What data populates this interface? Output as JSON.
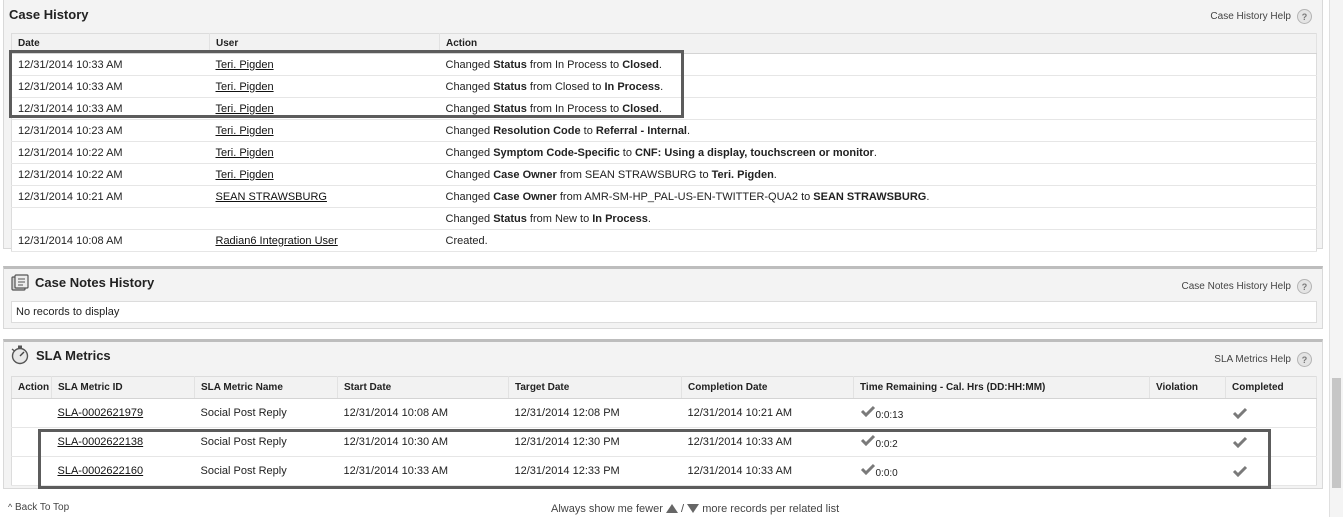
{
  "case_history": {
    "title": "Case History",
    "help_label": "Case History Help",
    "help_glyph": "?",
    "columns": [
      "Date",
      "User",
      "Action"
    ],
    "rows": [
      {
        "date": "12/31/2014 10:33 AM",
        "user": "Teri. Pigden",
        "action": [
          [
            "Changed ",
            false
          ],
          [
            "Status",
            true
          ],
          [
            " from In Process to ",
            false
          ],
          [
            "Closed",
            true
          ],
          [
            ".",
            false
          ]
        ]
      },
      {
        "date": "12/31/2014 10:33 AM",
        "user": "Teri. Pigden",
        "action": [
          [
            "Changed ",
            false
          ],
          [
            "Status",
            true
          ],
          [
            " from Closed to ",
            false
          ],
          [
            "In Process",
            true
          ],
          [
            ".",
            false
          ]
        ]
      },
      {
        "date": "12/31/2014 10:33 AM",
        "user": "Teri. Pigden",
        "action": [
          [
            "Changed ",
            false
          ],
          [
            "Status",
            true
          ],
          [
            " from In Process to ",
            false
          ],
          [
            "Closed",
            true
          ],
          [
            ".",
            false
          ]
        ]
      },
      {
        "date": "12/31/2014 10:23 AM",
        "user": "Teri. Pigden",
        "action": [
          [
            "Changed ",
            false
          ],
          [
            "Resolution Code",
            true
          ],
          [
            " to ",
            false
          ],
          [
            "Referral - Internal",
            true
          ],
          [
            ".",
            false
          ]
        ]
      },
      {
        "date": "12/31/2014 10:22 AM",
        "user": "Teri. Pigden",
        "action": [
          [
            "Changed ",
            false
          ],
          [
            "Symptom Code-Specific",
            true
          ],
          [
            " to ",
            false
          ],
          [
            "CNF: Using a display, touchscreen or monitor",
            true
          ],
          [
            ".",
            false
          ]
        ]
      },
      {
        "date": "12/31/2014 10:22 AM",
        "user": "Teri. Pigden",
        "action": [
          [
            "Changed ",
            false
          ],
          [
            "Case Owner",
            true
          ],
          [
            " from SEAN STRAWSBURG to ",
            false
          ],
          [
            "Teri. Pigden",
            true
          ],
          [
            ".",
            false
          ]
        ]
      },
      {
        "date": "12/31/2014 10:21 AM",
        "user": "SEAN STRAWSBURG",
        "action": [
          [
            "Changed ",
            false
          ],
          [
            "Case Owner",
            true
          ],
          [
            " from AMR-SM-HP_PAL-US-EN-TWITTER-QUA2 to ",
            false
          ],
          [
            "SEAN STRAWSBURG",
            true
          ],
          [
            ".",
            false
          ]
        ]
      },
      {
        "date": "",
        "user": "",
        "action": [
          [
            "Changed ",
            false
          ],
          [
            "Status",
            true
          ],
          [
            " from New to ",
            false
          ],
          [
            "In Process",
            true
          ],
          [
            ".",
            false
          ]
        ]
      },
      {
        "date": "12/31/2014 10:08 AM",
        "user": "Radian6 Integration User",
        "action": [
          [
            "Created.",
            false
          ]
        ]
      }
    ]
  },
  "case_notes": {
    "title": "Case Notes History",
    "help_label": "Case Notes History Help",
    "help_glyph": "?",
    "empty_text": "No records to display"
  },
  "sla": {
    "title": "SLA Metrics",
    "help_label": "SLA Metrics Help",
    "help_glyph": "?",
    "columns": [
      "Action",
      "SLA Metric ID",
      "SLA Metric Name",
      "Start Date",
      "Target Date",
      "Completion Date",
      "Time Remaining - Cal. Hrs (DD:HH:MM)",
      "Violation",
      "Completed"
    ],
    "rows": [
      {
        "id": "SLA-0002621979",
        "name": "Social Post Reply",
        "start": "12/31/2014 10:08 AM",
        "target": "12/31/2014 12:08 PM",
        "completion": "12/31/2014 10:21 AM",
        "remaining": "0:0:13",
        "violation": "",
        "completed": true
      },
      {
        "id": "SLA-0002622138",
        "name": "Social Post Reply",
        "start": "12/31/2014 10:30 AM",
        "target": "12/31/2014 12:30 PM",
        "completion": "12/31/2014 10:33 AM",
        "remaining": "0:0:2",
        "violation": "",
        "completed": true
      },
      {
        "id": "SLA-0002622160",
        "name": "Social Post Reply",
        "start": "12/31/2014 10:33 AM",
        "target": "12/31/2014 12:33 PM",
        "completion": "12/31/2014 10:33 AM",
        "remaining": "0:0:0",
        "violation": "",
        "completed": true
      }
    ]
  },
  "footer": {
    "back_to_top": "Back To Top",
    "prefix": "Always show me fewer",
    "sep": "/",
    "suffix": "more records per related list"
  },
  "icons": {
    "checkmark_color": "#7a7a7a",
    "highlight_border": "#5c5c5c"
  }
}
